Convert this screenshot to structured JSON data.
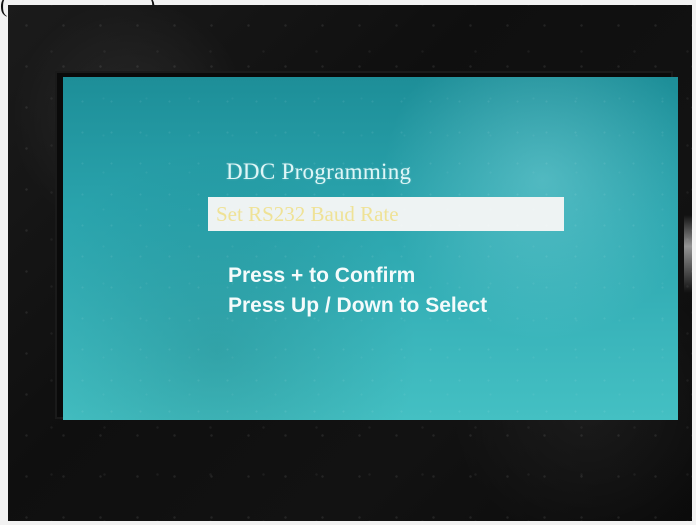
{
  "page": {
    "left_glyph": "(",
    "right_glyph": ")"
  },
  "osd": {
    "title": "DDC Programming",
    "selected_item": "Set RS232 Baud Rate",
    "instructions": [
      "Press + to Confirm",
      "Press Up / Down to Select"
    ]
  },
  "colors": {
    "screen": "#2aa4ad",
    "title_text": "#dff6f7",
    "highlight_bar": "#eef3f3",
    "selected_text": "#efe296",
    "instruction_text": "#f4fbfb",
    "bezel": "#0a0a0a"
  }
}
